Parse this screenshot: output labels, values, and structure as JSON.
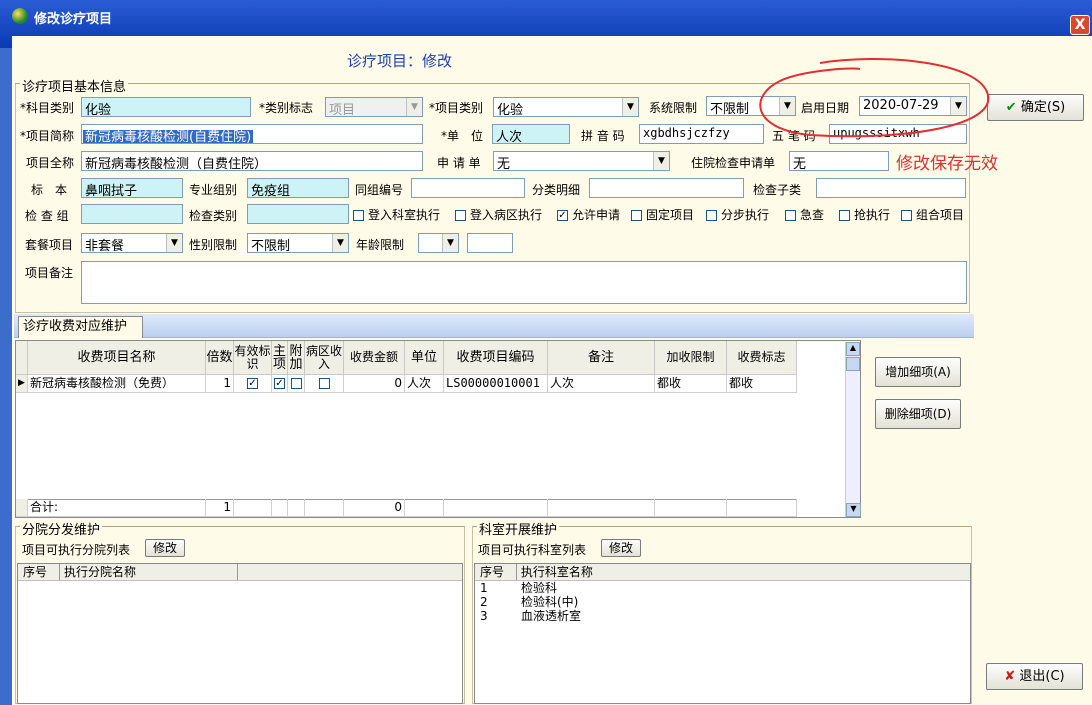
{
  "window": {
    "title": "修改诊疗项目",
    "close": "X"
  },
  "header_note": "诊疗项目：修改",
  "basic": {
    "group_title": "诊疗项目基本信息",
    "category_label": "*科目类别",
    "category_value": "化验",
    "type_flag_label": "*类别标志",
    "type_flag_value": "项目",
    "item_category_label": "*项目类别",
    "item_category_value": "化验",
    "sys_limit_label": "系统限制",
    "sys_limit_value": "不限制",
    "start_date_label": "启用日期",
    "start_date_value": "2020-07-29",
    "short_name_label": "*项目简称",
    "short_name_value": "新冠病毒核酸检测(自费住院)",
    "unit_label": "*单　位",
    "unit_value": "人次",
    "pinyin_label": "拼 音 码",
    "pinyin_value": "xgbdhsjczfzy",
    "wubi_label": "五 笔 码",
    "wubi_value": "upugsssitxwh",
    "full_name_label": "项目全称",
    "full_name_value": "新冠病毒核酸检测（自费住院）",
    "apply_label": "申 请 单",
    "apply_value": "无",
    "inpatient_apply_label": "住院检查申请单",
    "inpatient_apply_value": "无",
    "specimen_label": "标　本",
    "specimen_value": "鼻咽拭子",
    "prof_group_label": "专业组别",
    "prof_group_value": "免疫组",
    "same_group_label": "同组编号",
    "same_group_value": "",
    "class_detail_label": "分类明细",
    "class_detail_value": "",
    "check_sub_label": "检查子类",
    "check_sub_value": "",
    "check_group_label": "检 查 组",
    "check_group_value": "",
    "check_type_label": "检查类别",
    "check_type_value": "",
    "package_label": "套餐项目",
    "package_value": "非套餐",
    "gender_label": "性别限制",
    "gender_value": "不限制",
    "age_label": "年龄限制",
    "age_value": "",
    "remark_label": "项目备注",
    "remark_value": "",
    "checks": [
      {
        "label": "登入科室执行",
        "checked": false
      },
      {
        "label": "登入病区执行",
        "checked": false
      },
      {
        "label": "允许申请",
        "checked": true
      },
      {
        "label": "固定项目",
        "checked": false
      },
      {
        "label": "分步执行",
        "checked": false
      },
      {
        "label": "急查",
        "checked": false
      },
      {
        "label": "抢执行",
        "checked": false
      },
      {
        "label": "组合项目",
        "checked": false
      }
    ]
  },
  "buttons": {
    "ok": "确定(S)",
    "exit": "退出(C)",
    "add_detail": "增加细项(A)",
    "del_detail": "删除细项(D)",
    "modify": "修改",
    "modify2": "修改"
  },
  "annotation": "修改保存无效",
  "fee_tab": "诊疗收费对应维护",
  "fee_table": {
    "headers": [
      "收费项目名称",
      "倍数",
      "有效标识",
      "主项",
      "附加",
      "病区收入",
      "收费金额",
      "单位",
      "收费项目编码",
      "备注",
      "加收限制",
      "收费标志"
    ],
    "rows": [
      {
        "name": "新冠病毒核酸检测（免费）",
        "multiple": "1",
        "valid": true,
        "main": true,
        "extra": false,
        "ward": false,
        "amount": "0",
        "unit": "人次",
        "code": "LS00000010001",
        "remark": "人次",
        "add_limit": "都收",
        "flag": "都收"
      }
    ],
    "total_label": "合计:",
    "total_multiple": "1",
    "total_amount": "0"
  },
  "branch": {
    "group_title": "分院分发维护",
    "list_label": "项目可执行分院列表",
    "headers": [
      "序号",
      "执行分院名称"
    ],
    "rows": []
  },
  "dept": {
    "group_title": "科室开展维护",
    "list_label": "项目可执行科室列表",
    "headers": [
      "序号",
      "执行科室名称"
    ],
    "rows": [
      {
        "no": "1",
        "name": "检验科"
      },
      {
        "no": "2",
        "name": "检验科(中)"
      },
      {
        "no": "3",
        "name": "血液透析室"
      }
    ]
  },
  "colors": {
    "accent": "#1a3fb0",
    "cyan_field": "#cdf3f6",
    "annotation": "#e03030"
  }
}
